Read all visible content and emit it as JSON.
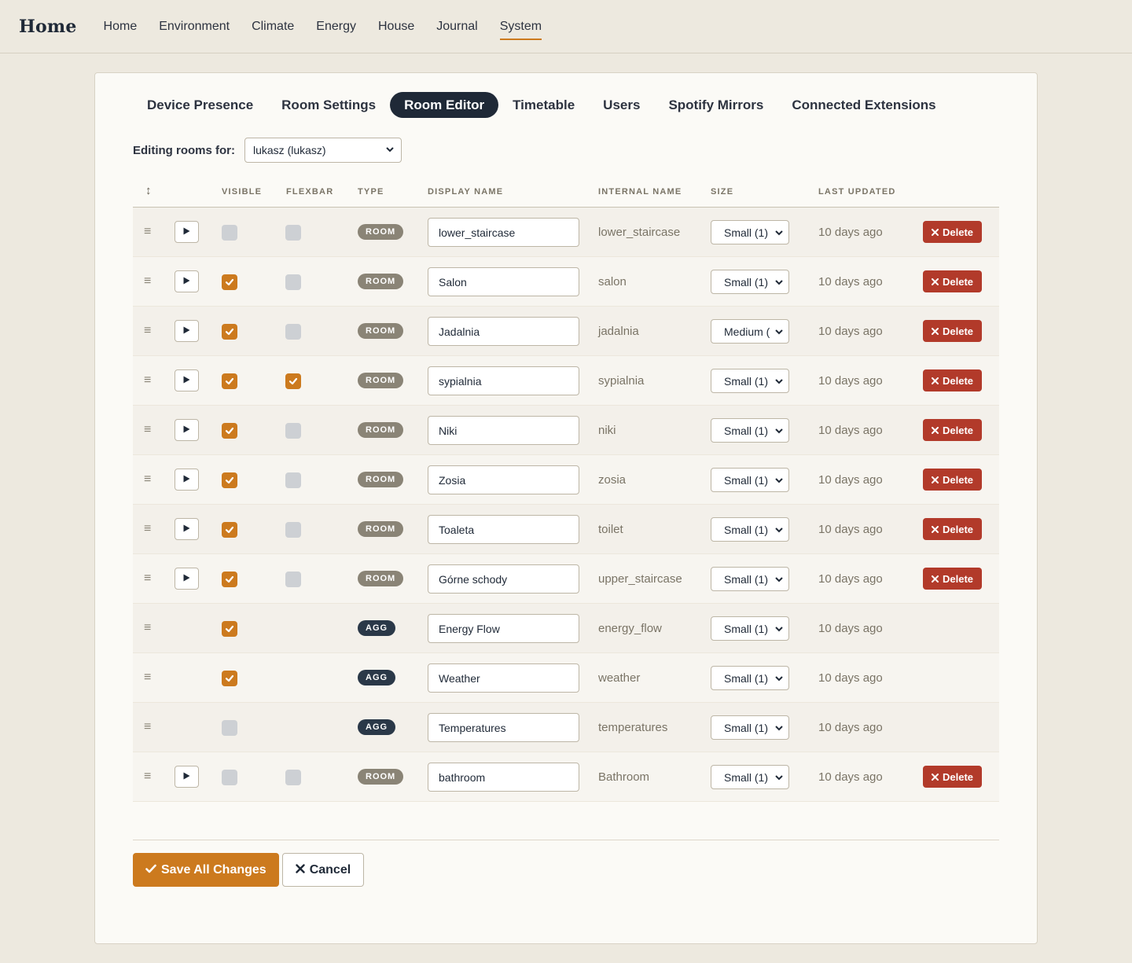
{
  "brand": "Home",
  "nav": [
    {
      "label": "Home"
    },
    {
      "label": "Environment"
    },
    {
      "label": "Climate"
    },
    {
      "label": "Energy"
    },
    {
      "label": "House"
    },
    {
      "label": "Journal"
    },
    {
      "label": "System",
      "active": true
    }
  ],
  "tabs": [
    {
      "label": "Device Presence"
    },
    {
      "label": "Room Settings"
    },
    {
      "label": "Room Editor",
      "active": true
    },
    {
      "label": "Timetable"
    },
    {
      "label": "Users"
    },
    {
      "label": "Spotify Mirrors"
    },
    {
      "label": "Connected Extensions"
    }
  ],
  "owner": {
    "label": "Editing rooms for:",
    "selected": "lukasz (lukasz)"
  },
  "table": {
    "headers": {
      "sort_icon": "↕",
      "visible": "Visible",
      "flexbar": "Flexbar",
      "type": "Type",
      "display_name": "Display Name",
      "internal_name": "Internal Name",
      "size": "Size",
      "last_updated": "Last Updated"
    },
    "delete_label": "Delete",
    "rows": [
      {
        "type": "ROOM",
        "display_name": "lower_staircase",
        "internal_name": "lower_staircase",
        "size": "Small (1)",
        "updated": "10 days ago",
        "visible": false,
        "flexbar": false
      },
      {
        "type": "ROOM",
        "display_name": "Salon",
        "internal_name": "salon",
        "size": "Small (1)",
        "updated": "10 days ago",
        "visible": true,
        "flexbar": false
      },
      {
        "type": "ROOM",
        "display_name": "Jadalnia",
        "internal_name": "jadalnia",
        "size": "Medium (",
        "updated": "10 days ago",
        "visible": true,
        "flexbar": false
      },
      {
        "type": "ROOM",
        "display_name": "sypialnia",
        "internal_name": "sypialnia",
        "size": "Small (1)",
        "updated": "10 days ago",
        "visible": true,
        "flexbar": true
      },
      {
        "type": "ROOM",
        "display_name": "Niki",
        "internal_name": "niki",
        "size": "Small (1)",
        "updated": "10 days ago",
        "visible": true,
        "flexbar": false
      },
      {
        "type": "ROOM",
        "display_name": "Zosia",
        "internal_name": "zosia",
        "size": "Small (1)",
        "updated": "10 days ago",
        "visible": true,
        "flexbar": false
      },
      {
        "type": "ROOM",
        "display_name": "Toaleta",
        "internal_name": "toilet",
        "size": "Small (1)",
        "updated": "10 days ago",
        "visible": true,
        "flexbar": false
      },
      {
        "type": "ROOM",
        "display_name": "Górne schody",
        "internal_name": "upper_staircase",
        "size": "Small (1)",
        "updated": "10 days ago",
        "visible": true,
        "flexbar": false
      },
      {
        "type": "AGG",
        "display_name": "Energy Flow",
        "internal_name": "energy_flow",
        "size": "Small (1)",
        "updated": "10 days ago",
        "visible": true
      },
      {
        "type": "AGG",
        "display_name": "Weather",
        "internal_name": "weather",
        "size": "Small (1)",
        "updated": "10 days ago",
        "visible": true
      },
      {
        "type": "AGG",
        "display_name": "Temperatures",
        "internal_name": "temperatures",
        "size": "Small (1)",
        "updated": "10 days ago",
        "visible": false
      },
      {
        "type": "ROOM",
        "display_name": "bathroom",
        "internal_name": "Bathroom",
        "size": "Small (1)",
        "updated": "10 days ago",
        "visible": false,
        "flexbar": false
      }
    ]
  },
  "actions": {
    "save": "Save All Changes",
    "cancel": "Cancel"
  },
  "colors": {
    "accent": "#cc7a1e",
    "danger": "#b23a2a",
    "dark": "#1f2937",
    "room_badge": "#8a8476",
    "agg_badge": "#2a3848"
  }
}
